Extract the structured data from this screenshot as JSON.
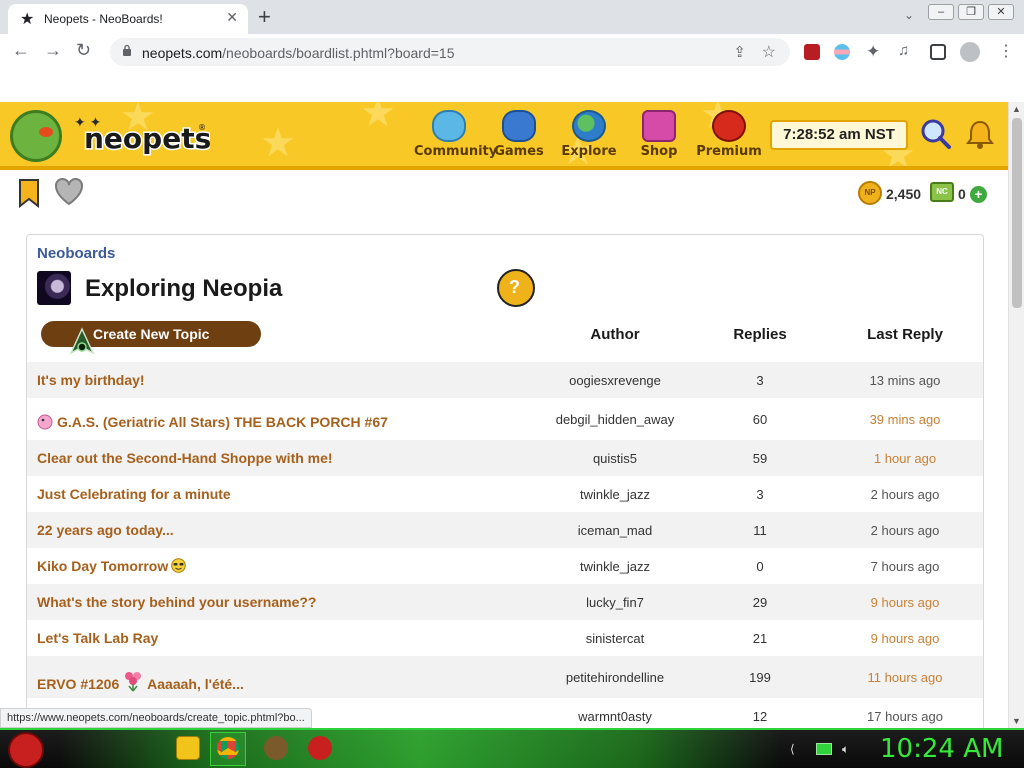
{
  "browser": {
    "tab_title": "Neopets - NeoBoards!",
    "url_host": "neopets.com",
    "url_path": "/neoboards/boardlist.phtml?board=15",
    "new_tab_label": "+",
    "tab_close": "✕",
    "status_url": "https://www.neopets.com/neoboards/create_topic.phtml?bo..."
  },
  "header": {
    "nav": [
      {
        "label": "Community",
        "color": "#5bb8e6"
      },
      {
        "label": "Games",
        "color": "#3a79d0"
      },
      {
        "label": "Explore",
        "color": "#3d9b3d"
      },
      {
        "label": "Shop",
        "color": "#d64aa8"
      },
      {
        "label": "Premium",
        "color": "#d62a1d"
      }
    ],
    "clock": "7:28:52 am NST"
  },
  "currency": {
    "np_coin_label": "NP",
    "np_amount": "2,450",
    "nc_label": "NC",
    "nc_amount": "0",
    "add_label": "+"
  },
  "board": {
    "breadcrumb": "Neoboards",
    "title": "Exploring Neopia",
    "help_glyph": "?",
    "create_button": "Create New Topic",
    "columns": {
      "author": "Author",
      "replies": "Replies",
      "last_reply": "Last Reply"
    },
    "topics": [
      {
        "title": "It's my birthday!",
        "author": "oogiesxrevenge",
        "replies": "3",
        "last": "13 mins ago",
        "recent": false
      },
      {
        "title": "G.A.S. (Geriatric All Stars) THE BACK PORCH #67",
        "author": "debgil_hidden_away",
        "replies": "60",
        "last": "39 mins ago",
        "recent": true
      },
      {
        "title": "Clear out the Second-Hand Shoppe with me!",
        "author": "quistis5",
        "replies": "59",
        "last": "1 hour ago",
        "recent": true
      },
      {
        "title": "Just Celebrating for a minute",
        "author": "twinkle_jazz",
        "replies": "3",
        "last": "2 hours ago",
        "recent": false
      },
      {
        "title": "22 years ago today...",
        "author": "iceman_mad",
        "replies": "11",
        "last": "2 hours ago",
        "recent": false
      },
      {
        "title": "Kiko Day Tomorrow",
        "author": "twinkle_jazz",
        "replies": "0",
        "last": "7 hours ago",
        "recent": false
      },
      {
        "title": "What's the story behind your username??",
        "author": "lucky_fin7",
        "replies": "29",
        "last": "9 hours ago",
        "recent": true
      },
      {
        "title": "Let's Talk Lab Ray",
        "author": "sinistercat",
        "replies": "21",
        "last": "9 hours ago",
        "recent": true
      },
      {
        "title_a": "ERVO #1206",
        "title_b": "Aaaaah, l'été...",
        "author": "petitehirondelline",
        "replies": "199",
        "last": "11 hours ago",
        "recent": true
      },
      {
        "author": "warmnt0asty",
        "replies": "12",
        "last": "17 hours ago",
        "recent": false
      }
    ]
  },
  "taskbar": {
    "clock": "10:24 AM"
  }
}
